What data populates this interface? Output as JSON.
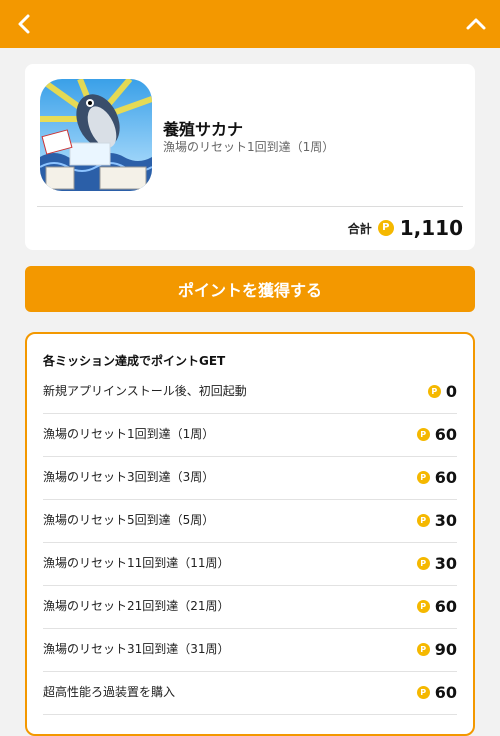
{
  "header": {
    "back_icon": "chevron-left-icon",
    "collapse_icon": "chevron-up-icon",
    "color": "#f39800"
  },
  "app": {
    "name": "養殖サカナ",
    "subtitle": "漁場のリセット1回到達（1周）",
    "icon": "fish-app-icon",
    "total_label": "合計",
    "total_value": "1,110",
    "coin_symbol": "P"
  },
  "cta": {
    "label": "ポイントを獲得する"
  },
  "missions": {
    "title": "各ミッション達成でポイントGET",
    "items": [
      {
        "label": "新規アプリインストール後、初回起動",
        "points": "0"
      },
      {
        "label": "漁場のリセット1回到達（1周）",
        "points": "60"
      },
      {
        "label": "漁場のリセット3回到達（3周）",
        "points": "60"
      },
      {
        "label": "漁場のリセット5回到達（5周）",
        "points": "30"
      },
      {
        "label": "漁場のリセット11回到達（11周）",
        "points": "30"
      },
      {
        "label": "漁場のリセット21回到達（21周）",
        "points": "60"
      },
      {
        "label": "漁場のリセット31回到達（31周）",
        "points": "90"
      },
      {
        "label": "超高性能ろ過装置を購入",
        "points": "60"
      }
    ]
  },
  "colors": {
    "accent": "#f39800",
    "coin": "#f5b800"
  }
}
